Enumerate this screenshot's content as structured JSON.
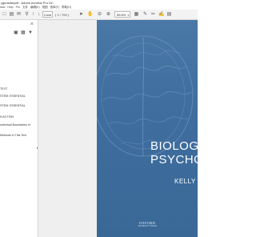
{
  "titlebar": {
    "text": "ygenstartpdf - Adobe Acrobat Pro DC"
  },
  "menubar": {
    "items": [
      "dow",
      "Help",
      "Pro",
      "文件",
      "编辑(E)",
      "视图",
      "表单(F)",
      "帮助(H)"
    ]
  },
  "toolbar": {
    "page_value": "Cove",
    "page_count": "( 1 / 700 )",
    "zoom_value": "59.6%"
  },
  "sidebar": {
    "bookmarks": [
      {
        "label": "TEXT"
      },
      {
        "label": "STEM: ESSENTIAL"
      },
      {
        "label": "STEM: ESSENTIAL"
      },
      {
        "label": "N ACTION"
      },
      {
        "label": "ontextual Boundaries of"
      },
      {
        "label": "Methods in This Text"
      }
    ]
  },
  "book": {
    "title_line1": "BIOLOGI",
    "title_line2": "PSYCHOLO",
    "author": "KELLY LA",
    "publisher": "OXFORD",
    "publisher_sub": "UNIVERSITY PRESS"
  },
  "colors": {
    "cover_blue": "#4373a3",
    "sidebar_bg": "#ffffff",
    "toolbar_bg": "#f3f3f3"
  }
}
